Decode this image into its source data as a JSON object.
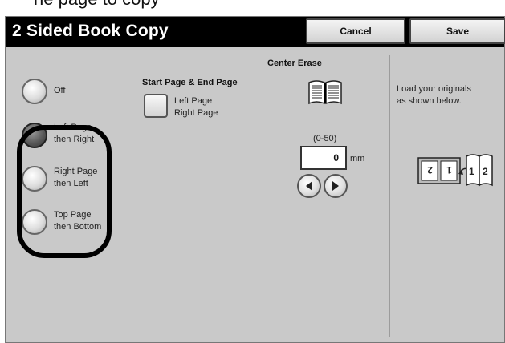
{
  "caption": "he page to copy",
  "window": {
    "title": "2 Sided Book Copy",
    "cancel_label": "Cancel",
    "save_label": "Save"
  },
  "options": [
    {
      "label_line1": "Off",
      "label_line2": "",
      "selected": false
    },
    {
      "label_line1": "Left Page",
      "label_line2": "then Right",
      "selected": true
    },
    {
      "label_line1": "Right Page",
      "label_line2": "then Left",
      "selected": false
    },
    {
      "label_line1": "Top Page",
      "label_line2": "then Bottom",
      "selected": false
    }
  ],
  "start_end": {
    "heading": "Start Page & End Page",
    "label_line1": "Left Page",
    "label_line2": "Right Page"
  },
  "center_erase": {
    "heading": "Center Erase",
    "range": "(0-50)",
    "value": "0",
    "unit": "mm"
  },
  "info": {
    "line1": "Load your originals",
    "line2": "as shown below."
  }
}
